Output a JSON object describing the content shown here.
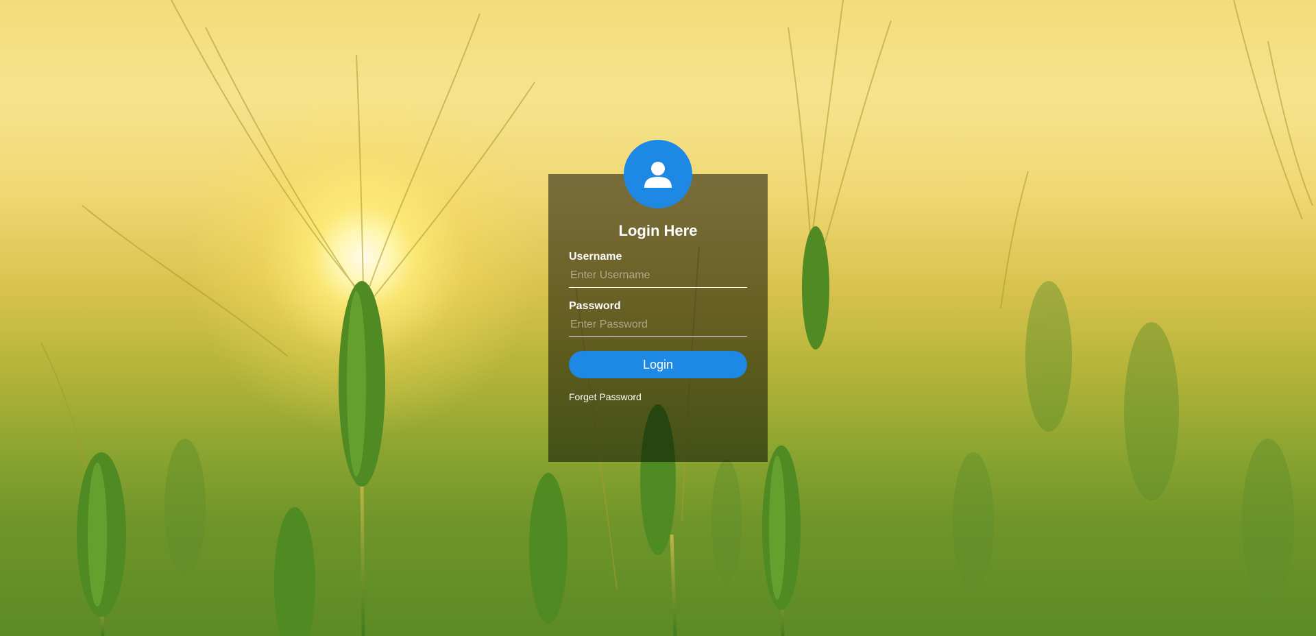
{
  "page": {
    "accent_color": "#1e88e5",
    "background_scene": "wheat field at sunrise"
  },
  "login_card": {
    "avatar_icon": "user-icon",
    "title": "Login Here",
    "username": {
      "label": "Username",
      "placeholder": "Enter Username",
      "value": ""
    },
    "password": {
      "label": "Password",
      "placeholder": "Enter Password",
      "value": ""
    },
    "login_button": "Login",
    "forget_password_link": "Forget Password"
  }
}
